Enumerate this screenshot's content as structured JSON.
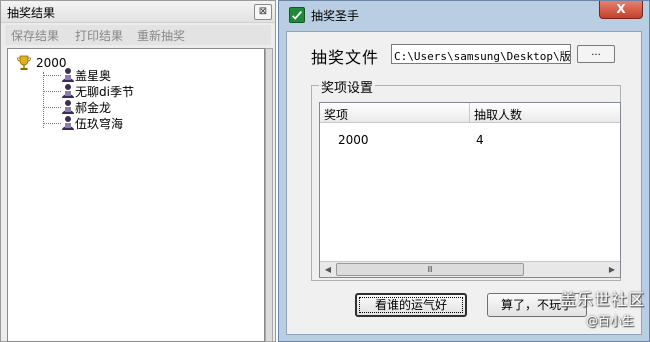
{
  "left_window": {
    "title": "抽奖结果",
    "close_glyph": "⊠",
    "menu": [
      "保存结果",
      "打印结果",
      "重新抽奖"
    ],
    "tree": {
      "root_label": "2000",
      "root_icon": "trophy-icon",
      "children": [
        "盖星奥",
        "无聊di季节",
        "郝金龙",
        "伍玖穹海"
      ],
      "child_icon": "person-icon"
    }
  },
  "right_window": {
    "title": "抽奖圣手",
    "close_glyph": "X",
    "file_label": "抽奖文件",
    "file_path": "C:\\Users\\samsung\\Desktop\\版块",
    "browse_label": "...",
    "group_title": "奖项设置",
    "columns": [
      "奖项",
      "抽取人数"
    ],
    "rows": [
      [
        "2000",
        "4"
      ]
    ],
    "scroll_thumb_glyph": "Ⅲ",
    "buttons": {
      "lucky": "看谁的运气好",
      "quit": "算了，不玩了"
    }
  },
  "watermark": {
    "site": "盖乐世社区",
    "user": "@百小生"
  },
  "colors": {
    "right_frame": "#b9cde3",
    "close_red": "#c2412b",
    "app_icon": "#1f8a3a"
  }
}
